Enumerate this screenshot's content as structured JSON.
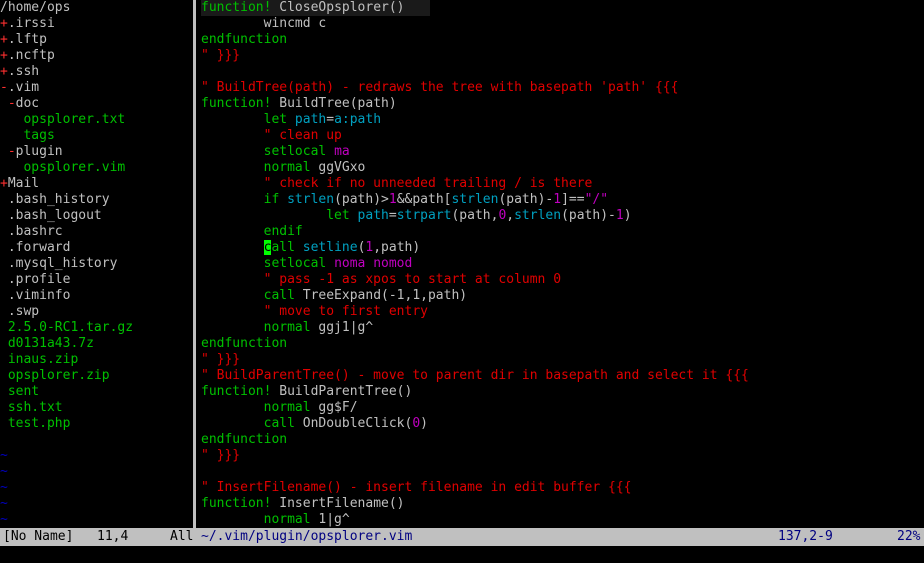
{
  "colors": {
    "fold_plus": "#ff3030",
    "dir": "#c0c0c0",
    "file": "#c0c0c0",
    "tree_leaf": "#00c000",
    "tilde": "#0000c0",
    "comment": "#e00000",
    "keyword": "#00c000",
    "text": "#c0c0c0",
    "number": "#c000c0",
    "builtin": "#00a0c0"
  },
  "tree": [
    [
      {
        "t": "/home/ops",
        "c": "dir"
      }
    ],
    [
      {
        "t": "+",
        "c": "fold_plus"
      },
      {
        "t": ".irssi",
        "c": "dir"
      }
    ],
    [
      {
        "t": "+",
        "c": "fold_plus"
      },
      {
        "t": ".lftp",
        "c": "dir"
      }
    ],
    [
      {
        "t": "+",
        "c": "fold_plus"
      },
      {
        "t": ".ncftp",
        "c": "dir"
      }
    ],
    [
      {
        "t": "+",
        "c": "fold_plus"
      },
      {
        "t": ".ssh",
        "c": "dir"
      }
    ],
    [
      {
        "t": "-",
        "c": "fold_plus"
      },
      {
        "t": ".vim",
        "c": "dir"
      }
    ],
    [
      {
        "t": " -",
        "c": "fold_plus"
      },
      {
        "t": "doc",
        "c": "dir"
      }
    ],
    [
      {
        "t": "   opsplorer.txt",
        "c": "tree_leaf"
      }
    ],
    [
      {
        "t": "   tags",
        "c": "tree_leaf"
      }
    ],
    [
      {
        "t": " -",
        "c": "fold_plus"
      },
      {
        "t": "plugin",
        "c": "dir"
      }
    ],
    [
      {
        "t": "   opsplorer.vim",
        "c": "tree_leaf"
      }
    ],
    [
      {
        "t": "+",
        "c": "fold_plus"
      },
      {
        "t": "Mail",
        "c": "dir"
      }
    ],
    [
      {
        "t": " .bash_history",
        "c": "file"
      }
    ],
    [
      {
        "t": " .bash_logout",
        "c": "file"
      }
    ],
    [
      {
        "t": " .bashrc",
        "c": "file"
      }
    ],
    [
      {
        "t": " .forward",
        "c": "file"
      }
    ],
    [
      {
        "t": " .mysql_history",
        "c": "file"
      }
    ],
    [
      {
        "t": " .profile",
        "c": "file"
      }
    ],
    [
      {
        "t": " .viminfo",
        "c": "file"
      }
    ],
    [
      {
        "t": " .swp",
        "c": "file"
      }
    ],
    [
      {
        "t": " 2.5.0-RC1.tar.gz",
        "c": "tree_leaf"
      }
    ],
    [
      {
        "t": " d0131a43.7z",
        "c": "tree_leaf"
      }
    ],
    [
      {
        "t": " inaus.zip",
        "c": "tree_leaf"
      }
    ],
    [
      {
        "t": " opsplorer.zip",
        "c": "tree_leaf"
      }
    ],
    [
      {
        "t": " sent",
        "c": "tree_leaf"
      }
    ],
    [
      {
        "t": " ssh.txt",
        "c": "tree_leaf"
      }
    ],
    [
      {
        "t": " test.php",
        "c": "tree_leaf"
      }
    ],
    [],
    [
      {
        "t": "~",
        "c": "tilde"
      }
    ],
    [
      {
        "t": "~",
        "c": "tilde"
      }
    ],
    [
      {
        "t": "~",
        "c": "tilde"
      }
    ],
    [
      {
        "t": "~",
        "c": "tilde"
      }
    ],
    [
      {
        "t": "~",
        "c": "tilde"
      }
    ]
  ],
  "code": [
    [
      {
        "t": "function! ",
        "c": "keyword"
      },
      {
        "t": "CloseOpsplorer()",
        "c": "text"
      }
    ],
    [
      {
        "t": "        wincmd c",
        "c": "text"
      }
    ],
    [
      {
        "t": "endfunction",
        "c": "keyword"
      }
    ],
    [
      {
        "t": "\" }}}",
        "c": "comment"
      }
    ],
    [],
    [
      {
        "t": "\" BuildTree(path) - redraws the tree with basepath 'path' {{{",
        "c": "comment"
      }
    ],
    [
      {
        "t": "function! ",
        "c": "keyword"
      },
      {
        "t": "BuildTree(path)",
        "c": "text"
      }
    ],
    [
      {
        "t": "        let ",
        "c": "keyword"
      },
      {
        "t": "path",
        "c": "builtin"
      },
      {
        "t": "=",
        "c": "text"
      },
      {
        "t": "a:path",
        "c": "builtin"
      }
    ],
    [
      {
        "t": "        \" clean up",
        "c": "comment"
      }
    ],
    [
      {
        "t": "        setlocal ",
        "c": "keyword"
      },
      {
        "t": "ma",
        "c": "number"
      }
    ],
    [
      {
        "t": "        normal ",
        "c": "keyword"
      },
      {
        "t": "ggVGxo",
        "c": "text"
      }
    ],
    [
      {
        "t": "        \" check if no unneeded trailing / is there",
        "c": "comment"
      }
    ],
    [
      {
        "t": "        if ",
        "c": "keyword"
      },
      {
        "t": "strlen",
        "c": "builtin"
      },
      {
        "t": "(path)>",
        "c": "text"
      },
      {
        "t": "1",
        "c": "number"
      },
      {
        "t": "&&path[",
        "c": "text"
      },
      {
        "t": "strlen",
        "c": "builtin"
      },
      {
        "t": "(path)-",
        "c": "text"
      },
      {
        "t": "1",
        "c": "number"
      },
      {
        "t": "]==",
        "c": "text"
      },
      {
        "t": "\"/\"",
        "c": "number"
      }
    ],
    [
      {
        "t": "                let ",
        "c": "keyword"
      },
      {
        "t": "path",
        "c": "builtin"
      },
      {
        "t": "=",
        "c": "text"
      },
      {
        "t": "strpart",
        "c": "builtin"
      },
      {
        "t": "(path,",
        "c": "text"
      },
      {
        "t": "0",
        "c": "number"
      },
      {
        "t": ",",
        "c": "text"
      },
      {
        "t": "strlen",
        "c": "builtin"
      },
      {
        "t": "(path)-",
        "c": "text"
      },
      {
        "t": "1",
        "c": "number"
      },
      {
        "t": ")",
        "c": "text"
      }
    ],
    [
      {
        "t": "        endif",
        "c": "keyword"
      }
    ],
    [
      {
        "t": "        ",
        "c": "text"
      },
      {
        "t": "c",
        "c": "cursor"
      },
      {
        "t": "all ",
        "c": "keyword"
      },
      {
        "t": "setline",
        "c": "builtin"
      },
      {
        "t": "(",
        "c": "text"
      },
      {
        "t": "1",
        "c": "number"
      },
      {
        "t": ",path)",
        "c": "text"
      }
    ],
    [
      {
        "t": "        setlocal ",
        "c": "keyword"
      },
      {
        "t": "noma nomod",
        "c": "number"
      }
    ],
    [
      {
        "t": "        \" pass -1 as xpos to start at column 0",
        "c": "comment"
      }
    ],
    [
      {
        "t": "        call ",
        "c": "keyword"
      },
      {
        "t": "TreeExpand(-1,1,path)",
        "c": "text"
      }
    ],
    [
      {
        "t": "        \" move to first entry",
        "c": "comment"
      }
    ],
    [
      {
        "t": "        normal ",
        "c": "keyword"
      },
      {
        "t": "ggj1|g^",
        "c": "text"
      }
    ],
    [
      {
        "t": "endfunction",
        "c": "keyword"
      }
    ],
    [
      {
        "t": "\" }}}",
        "c": "comment"
      }
    ],
    [
      {
        "t": "\" BuildParentTree() - move to parent dir in basepath and select it {{{",
        "c": "comment"
      }
    ],
    [
      {
        "t": "function! ",
        "c": "keyword"
      },
      {
        "t": "BuildParentTree()",
        "c": "text"
      }
    ],
    [
      {
        "t": "        normal ",
        "c": "keyword"
      },
      {
        "t": "gg$F/",
        "c": "text"
      }
    ],
    [
      {
        "t": "        call ",
        "c": "keyword"
      },
      {
        "t": "OnDoubleClick(",
        "c": "text"
      },
      {
        "t": "0",
        "c": "number"
      },
      {
        "t": ")",
        "c": "text"
      }
    ],
    [
      {
        "t": "endfunction",
        "c": "keyword"
      }
    ],
    [
      {
        "t": "\" }}}",
        "c": "comment"
      }
    ],
    [],
    [
      {
        "t": "\" InsertFilename() - insert filename in edit buffer {{{",
        "c": "comment"
      }
    ],
    [
      {
        "t": "function! ",
        "c": "keyword"
      },
      {
        "t": "InsertFilename()",
        "c": "text"
      }
    ],
    [
      {
        "t": "        normal ",
        "c": "keyword"
      },
      {
        "t": "1|g^",
        "c": "text"
      }
    ]
  ],
  "status": {
    "left_name": "[No Name]",
    "left_pos": "11,4",
    "left_all": "All",
    "file_path": "~/.vim/plugin/opsplorer.vim",
    "cursor_pos": "137,2-9",
    "percent": "22%"
  }
}
